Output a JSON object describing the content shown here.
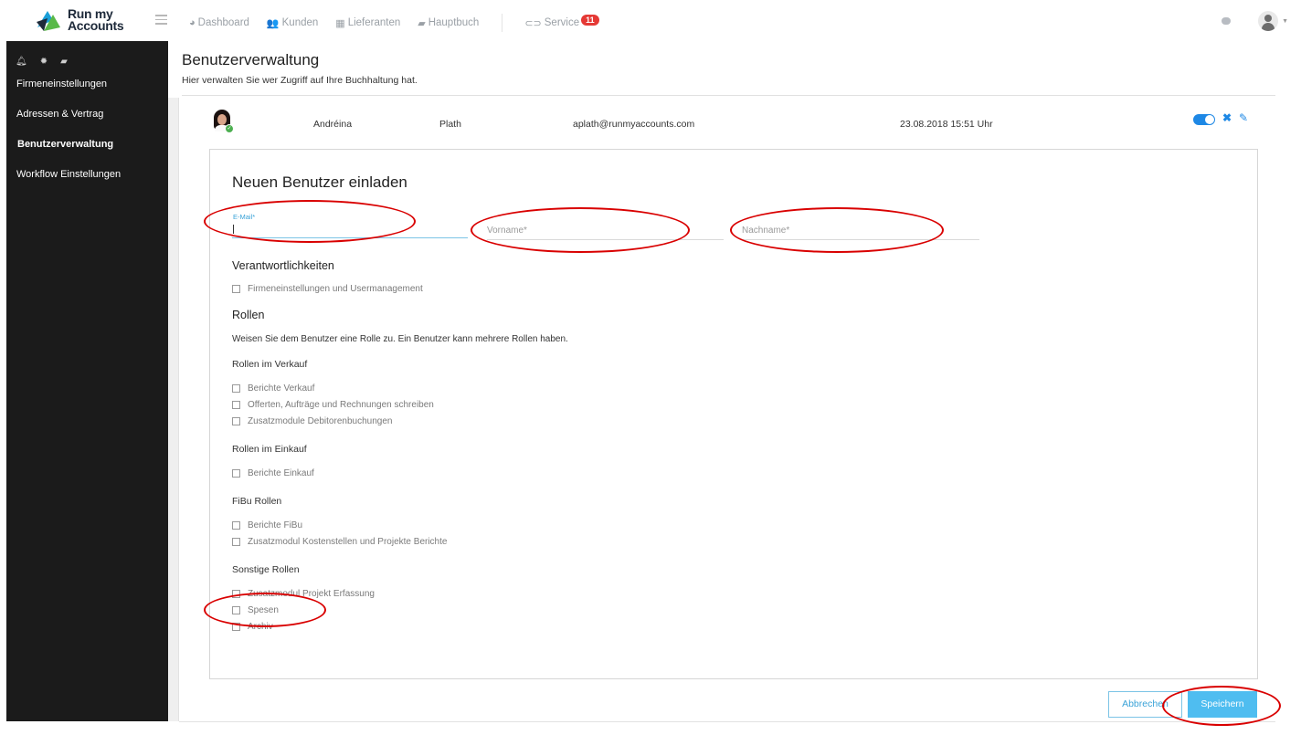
{
  "app": {
    "logo_line1": "Run my",
    "logo_line2": "Accounts"
  },
  "topnav": {
    "items": [
      {
        "label": "Dashboard",
        "icon": "dashboard-icon"
      },
      {
        "label": "Kunden",
        "icon": "customers-icon"
      },
      {
        "label": "Lieferanten",
        "icon": "suppliers-icon"
      },
      {
        "label": "Hauptbuch",
        "icon": "ledger-icon"
      }
    ],
    "service_label": "Service",
    "service_badge": "11"
  },
  "sidebar": {
    "items": [
      {
        "label": "Firmeneinstellungen"
      },
      {
        "label": "Adressen & Vertrag"
      },
      {
        "label": "Benutzerverwaltung"
      },
      {
        "label": "Workflow Einstellungen"
      }
    ]
  },
  "page": {
    "title": "Benutzerverwaltung",
    "subtitle": "Hier verwalten Sie wer Zugriff auf Ihre Buchhaltung hat."
  },
  "user_row": {
    "first_name": "Andréina",
    "last_name": "Plath",
    "email": "aplath@runmyaccounts.com",
    "date": "23.08.2018 15:51 Uhr",
    "active": true
  },
  "invite": {
    "title": "Neuen Benutzer einladen",
    "email_label": "E-Mail*",
    "email_value": "",
    "vorname_placeholder": "Vorname*",
    "nachname_placeholder": "Nachname*",
    "resp_title": "Verantwortlichkeiten",
    "resp_options": [
      "Firmeneinstellungen und Usermanagement"
    ],
    "roles_title": "Rollen",
    "roles_desc": "Weisen Sie dem Benutzer eine Rolle zu. Ein Benutzer kann mehrere Rollen haben.",
    "groups": [
      {
        "title": "Rollen im Verkauf",
        "options": [
          "Berichte Verkauf",
          "Offerten, Aufträge und Rechnungen schreiben",
          "Zusatzmodule Debitorenbuchungen"
        ]
      },
      {
        "title": "Rollen im Einkauf",
        "options": [
          "Berichte Einkauf"
        ]
      },
      {
        "title": "FiBu Rollen",
        "options": [
          "Berichte FiBu",
          "Zusatzmodul Kostenstellen und Projekte Berichte"
        ]
      },
      {
        "title": "Sonstige Rollen",
        "options": [
          "Zusatzmodul Projekt Erfassung",
          "Spesen",
          "Archiv"
        ]
      }
    ]
  },
  "buttons": {
    "cancel": "Abbrechen",
    "save": "Speichern"
  },
  "colors": {
    "accent": "#1e88e5",
    "primary_button": "#4fbdf0",
    "sidebar_bg": "#1b1b1b",
    "annotation": "#d90000"
  }
}
